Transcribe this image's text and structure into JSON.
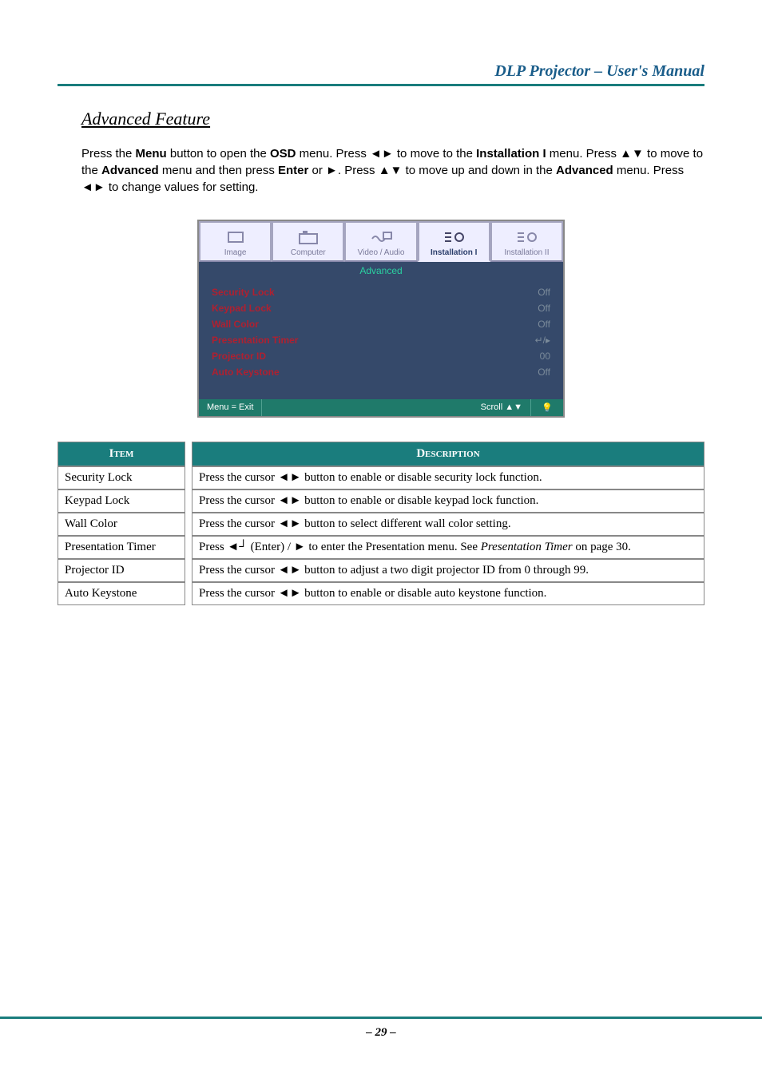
{
  "header": {
    "title": "DLP Projector – User's Manual"
  },
  "section": {
    "title": "Advanced Feature"
  },
  "instructions": {
    "parts": [
      "Press the ",
      "Menu",
      " button to open the ",
      "OSD",
      " menu. Press ◄► to move to the ",
      "Installation I",
      " menu. Press ▲▼ to move to the ",
      "Advanced",
      " menu and then press ",
      "Enter",
      " or ►. Press ▲▼ to move up and down in the ",
      "Advanced",
      " menu. Press ◄► to change values for setting."
    ],
    "bold_indices": [
      1,
      3,
      5,
      7,
      9,
      11
    ]
  },
  "osd": {
    "tabs": [
      {
        "label": "Image"
      },
      {
        "label": "Computer"
      },
      {
        "label": "Video / Audio"
      },
      {
        "label": "Installation I",
        "active": true
      },
      {
        "label": "Installation II"
      }
    ],
    "subtitle": "Advanced",
    "rows": [
      {
        "k": "Security Lock",
        "v": "Off"
      },
      {
        "k": "Keypad Lock",
        "v": "Off"
      },
      {
        "k": "Wall Color",
        "v": "Off"
      },
      {
        "k": "Presentation Timer",
        "v": "↵/▸"
      },
      {
        "k": "Projector ID",
        "v": "00"
      },
      {
        "k": "Auto Keystone",
        "v": "Off"
      }
    ],
    "footer": {
      "left": "Menu = Exit",
      "right": "Scroll ▲▼",
      "help": "💡"
    }
  },
  "table": {
    "headers": {
      "item": "Item",
      "desc": "Description"
    },
    "rows": [
      {
        "item": "Security Lock",
        "desc": "Press the cursor ◄► button to enable or disable security lock function."
      },
      {
        "item": "Keypad Lock",
        "desc": "Press the cursor ◄► button to enable or disable keypad lock function."
      },
      {
        "item": "Wall Color",
        "desc": "Press the cursor ◄► button to select different wall color setting."
      },
      {
        "item": "Presentation Timer",
        "desc_html": "Press ◄┘ (Enter) / ► to enter the Presentation menu. See <i>Presentation Timer</i> on page 30."
      },
      {
        "item": "Projector ID",
        "desc": "Press the cursor ◄► button to adjust a two digit projector ID from 0 through 99."
      },
      {
        "item": "Auto Keystone",
        "desc": "Press the cursor ◄► button to enable or disable auto keystone function."
      }
    ]
  },
  "footer": {
    "page": "– 29 –"
  }
}
